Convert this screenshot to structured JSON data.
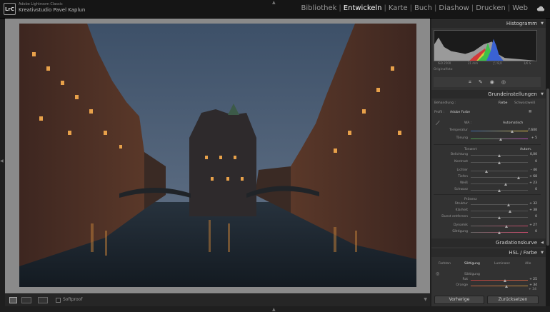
{
  "app": {
    "name": "Adobe Lightroom Classic",
    "studio": "Kreativstudio Pavel Kaplun",
    "logo": "LrC"
  },
  "modules": [
    "Bibliothek",
    "Entwickeln",
    "Karte",
    "Buch",
    "Diashow",
    "Drucken",
    "Web"
  ],
  "active_module": "Entwickeln",
  "arrows": {
    "up": "▲",
    "down": "▼",
    "left": "◀",
    "right": "▶"
  },
  "toolbar": {
    "softproof": "Softproof"
  },
  "panel": {
    "histogram": {
      "title": "Histogramm",
      "iso": "ISO 2500",
      "focal": "21 mm",
      "aperture": "ƒ / 8,0",
      "shutter": "1/6 S",
      "original_label": "Originalfoto"
    },
    "basic": {
      "title": "Grundeinstellungen",
      "treatment_label": "Behandlung :",
      "treatment_color": "Farbe",
      "treatment_bw": "Schwarzweiß",
      "profile_label": "Profil :",
      "profile_value": "Adobe Farbe",
      "wb_label": "WA :",
      "wb_value": "Automatisch",
      "temp_label": "Temperatur",
      "temp_value": "7.600",
      "tint_label": "Tönung",
      "tint_value": "+ 5",
      "tone_title": "Tonwert",
      "tone_auto": "Autom.",
      "exposure_label": "Belichtung",
      "exposure_value": "0,00",
      "contrast_label": "Kontrast",
      "contrast_value": "0",
      "highlights_label": "Lichter",
      "highlights_value": "– 46",
      "shadows_label": "Tiefen",
      "shadows_value": "+ 68",
      "whites_label": "Weiß",
      "whites_value": "+ 23",
      "blacks_label": "Schwarz",
      "blacks_value": "0",
      "presence_title": "Präsenz",
      "texture_label": "Struktur",
      "texture_value": "+ 32",
      "clarity_label": "Klarheit",
      "clarity_value": "+ 38",
      "dehaze_label": "Dunst entfernen",
      "dehaze_value": "0",
      "vibrance_label": "Dynamik",
      "vibrance_value": "+ 27",
      "saturation_label": "Sättigung",
      "saturation_value": "0"
    },
    "sliders": {
      "temp": 0.72,
      "tint": 0.52,
      "exposure": 0.5,
      "contrast": 0.5,
      "highlights": 0.27,
      "shadows": 0.84,
      "whites": 0.61,
      "blacks": 0.5,
      "texture": 0.66,
      "clarity": 0.69,
      "dehaze": 0.5,
      "vibrance": 0.63,
      "saturation": 0.5,
      "hsl_red": 0.6,
      "hsl_orange": 0.62
    },
    "curve": {
      "title": "Gradationskurve"
    },
    "hsl": {
      "title": "HSL / Farbe",
      "tabs": [
        "Farbton",
        "Sättigung",
        "Luminanz",
        "Alle"
      ],
      "active_tab": "Sättigung",
      "section": "Sättigung",
      "red_label": "Rot",
      "red_value": "+ 25",
      "orange_label": "Orange",
      "orange_value": "+ 34",
      "yellow_value": "+ 34"
    },
    "buttons": {
      "previous": "Vorherige",
      "reset": "Zurücksetzen"
    }
  },
  "colors": {
    "accent": "#c8c8c8",
    "panel_bg": "#323232",
    "header_bg": "#2a2a2a",
    "canvas_bg": "#8a8a8a"
  }
}
